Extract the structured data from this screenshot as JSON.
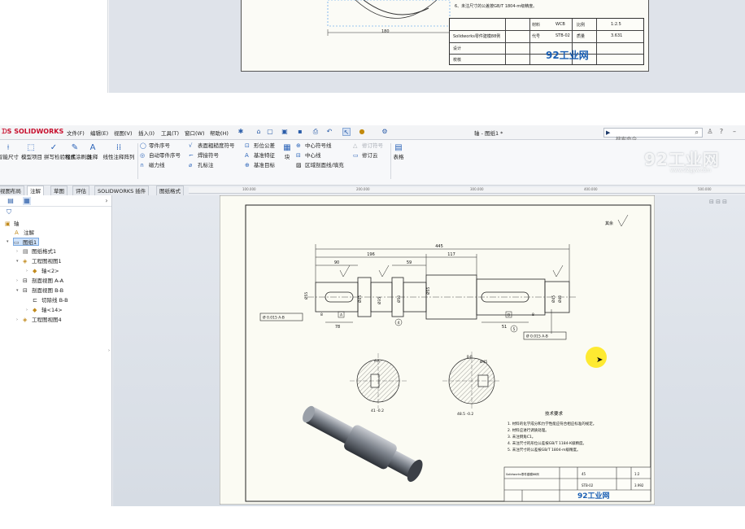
{
  "top_fragment": {
    "dimension": "180",
    "notes": [
      "6、未注尺寸的公差按GB/T 1804-m级精度。"
    ],
    "title_block": {
      "part_title": "Solidworks零件建模88例",
      "material_label": "材料",
      "material_value": "WCB",
      "scale_label": "比例",
      "scale_value": "1:2.5",
      "code_label": "代号",
      "code_value": "STB-02",
      "weight_label": "质量",
      "weight_value": "3.631",
      "design_label": "设计",
      "check_label": "校核",
      "brand": "92工业网"
    }
  },
  "app": {
    "logo": "SOLIDWORKS",
    "menu": [
      "文件(F)",
      "编辑(E)",
      "视图(V)",
      "插入(I)",
      "工具(T)",
      "窗口(W)",
      "帮助(H)"
    ],
    "document_title": "轴 - 图纸1 *",
    "search_placeholder": "搜索命令",
    "ribbon": {
      "smart_dimension": "智能尺寸",
      "model_items": "模型项目",
      "spell_check": "拼写检验程序",
      "format_painter": "格式涂刷器",
      "note": "注释",
      "linear_pattern": "线性注释阵列",
      "balloon": "零件序号",
      "auto_balloon": "自动零件序号",
      "magnetic_line": "磁力线",
      "surface_finish": "表面粗糙度符号",
      "weld_symbol": "焊接符号",
      "hole_callout": "孔标注",
      "gtol": "形位公差",
      "datum_feature": "基准特征",
      "datum_target": "基准目标",
      "blocks": "块",
      "center_mark": "中心符号线",
      "centerline": "中心线",
      "area_hatch": "区域剖面线/填充",
      "revision_symbol": "修订符号",
      "revision_cloud": "修订云",
      "tables": "表格"
    },
    "tabs": [
      "视图布局",
      "注解",
      "草图",
      "评估",
      "SOLIDWORKS 插件",
      "图纸格式"
    ],
    "ruler": [
      "100.000",
      "200.000",
      "300.000",
      "400.000",
      "500.000"
    ],
    "tree": [
      {
        "label": "轴"
      },
      {
        "label": "注解"
      },
      {
        "label": "图纸1"
      },
      {
        "label": "图纸格式1"
      },
      {
        "label": "工程图视图1"
      },
      {
        "label": "轴<2>"
      },
      {
        "label": "剖面视图 A-A"
      },
      {
        "label": "剖面视图 B-B"
      },
      {
        "label": "切除线 B-B"
      },
      {
        "label": "轴<14>"
      },
      {
        "label": "工程图视图4"
      }
    ],
    "drawing": {
      "dims": [
        "445",
        "196",
        "117",
        "90",
        "59",
        "Ø55",
        "Ø35",
        "Ø55",
        "78",
        "8",
        "8",
        "51",
        "Ø45",
        "Ø50",
        "Ø45",
        "Ø40"
      ],
      "gtol_left": "Ø 0.015 A-B",
      "gtol_right": "Ø 0.015 A-B",
      "section_a": "A-A",
      "section_b": "B-B",
      "sec_a_dim": "41 -0.2",
      "sec_b_dim": "48.5 -0.2",
      "sec_b_dia": "Ø45",
      "rest_label": "其余",
      "tech_title": "技术要求",
      "tech_notes": [
        "1. 材料的化学成分和力学性能应符合相应标准的规定。",
        "2. 材料应进行调质处理。",
        "3. 未注倒角C1。",
        "4. 未注尺寸的形位公差按GB/T 1184-K级精度。",
        "5. 未注尺寸的公差按GB/T 1804-m级精度。"
      ],
      "title_block": {
        "part_title": "Solidworks零件建模88例",
        "material_value": "45",
        "scale_value": "1:2",
        "code_value": "STB-02",
        "weight_value": "3.992",
        "brand": "92工业网"
      },
      "datum_a": "A",
      "datum_b": "B",
      "balloon_4": "4",
      "balloon_5": "5"
    },
    "watermark": "92工业网",
    "watermark_sub": "www.92gyw.com"
  }
}
